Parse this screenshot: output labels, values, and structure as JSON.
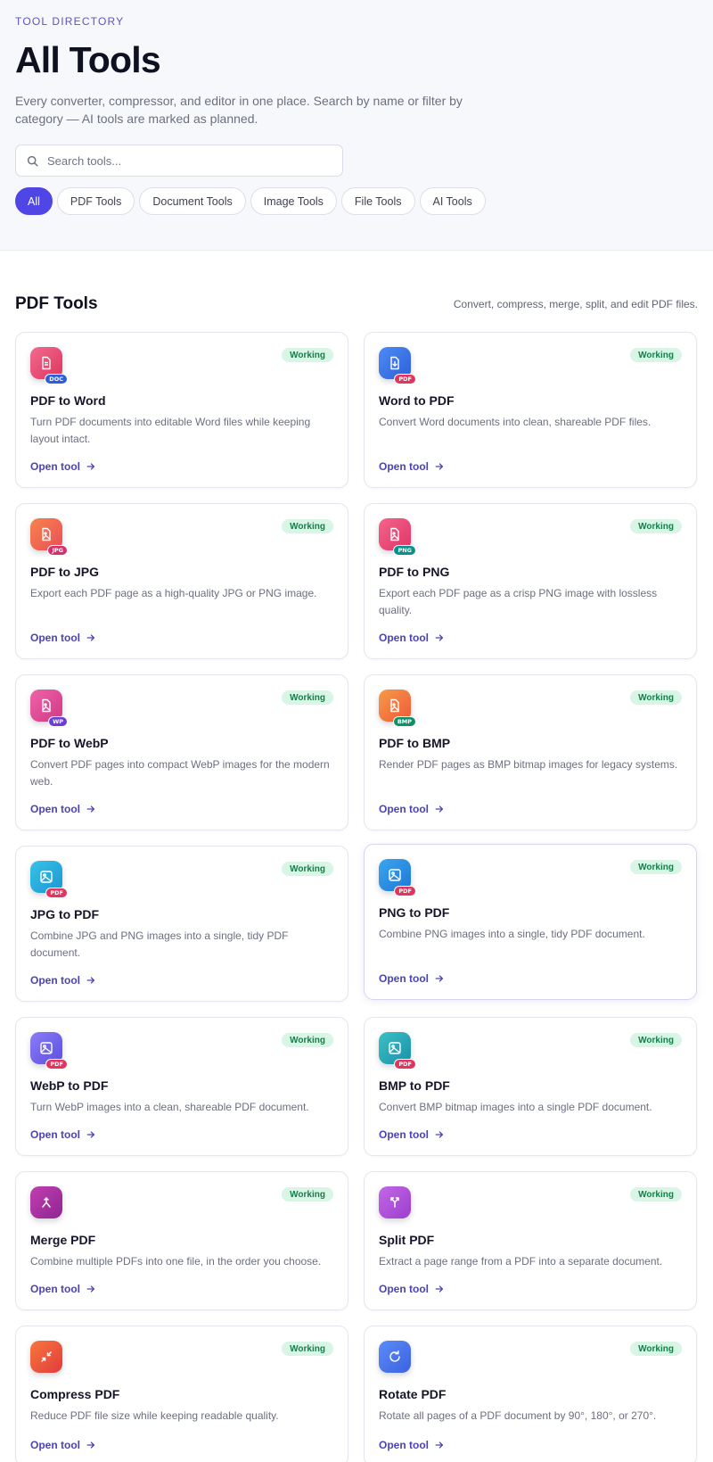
{
  "header": {
    "eyebrow": "TOOL DIRECTORY",
    "title": "All Tools",
    "description": "Every converter, compressor, and editor in one place. Search by name or filter by category — AI tools are marked as planned."
  },
  "search": {
    "placeholder": "Search tools..."
  },
  "filters": [
    {
      "label": "All",
      "active": true
    },
    {
      "label": "PDF Tools"
    },
    {
      "label": "Document Tools"
    },
    {
      "label": "Image Tools"
    },
    {
      "label": "File Tools"
    },
    {
      "label": "AI Tools"
    }
  ],
  "section": {
    "title": "PDF Tools",
    "subtitle": "Convert, compress, merge, split, and edit PDF files."
  },
  "link_label": "Open tool",
  "tools": [
    {
      "title": "PDF to Word",
      "description": "Turn PDF documents into editable Word files while keeping layout intact.",
      "status": "Working",
      "badge": "DOC",
      "icon": "document-icon"
    },
    {
      "title": "Word to PDF",
      "description": "Convert Word documents into clean, shareable PDF files.",
      "status": "Working",
      "badge": "PDF",
      "icon": "download-file-icon"
    },
    {
      "title": "PDF to JPG",
      "description": "Export each PDF page as a high-quality JPG or PNG image.",
      "status": "Working",
      "badge": "JPG",
      "icon": "image-file-icon"
    },
    {
      "title": "PDF to PNG",
      "description": "Export each PDF page as a crisp PNG image with lossless quality.",
      "status": "Working",
      "badge": "PNG",
      "icon": "image-file-icon"
    },
    {
      "title": "PDF to WebP",
      "description": "Convert PDF pages into compact WebP images for the modern web.",
      "status": "Working",
      "badge": "WP",
      "icon": "image-file-icon"
    },
    {
      "title": "PDF to BMP",
      "description": "Render PDF pages as BMP bitmap images for legacy systems.",
      "status": "Working",
      "badge": "BMP",
      "icon": "image-file-icon"
    },
    {
      "title": "JPG to PDF",
      "description": "Combine JPG and PNG images into a single, tidy PDF document.",
      "status": "Working",
      "badge": "PDF",
      "icon": "image-icon"
    },
    {
      "title": "PNG to PDF",
      "description": "Combine PNG images into a single, tidy PDF document.",
      "status": "Working",
      "badge": "PDF",
      "icon": "image-icon"
    },
    {
      "title": "WebP to PDF",
      "description": "Turn WebP images into a clean, shareable PDF document.",
      "status": "Working",
      "badge": "PDF",
      "icon": "image-icon"
    },
    {
      "title": "BMP to PDF",
      "description": "Convert BMP bitmap images into a single PDF document.",
      "status": "Working",
      "badge": "PDF",
      "icon": "image-icon"
    },
    {
      "title": "Merge PDF",
      "description": "Combine multiple PDFs into one file, in the order you choose.",
      "status": "Working",
      "badge": "",
      "icon": "merge-icon"
    },
    {
      "title": "Split PDF",
      "description": "Extract a page range from a PDF into a separate document.",
      "status": "Working",
      "badge": "",
      "icon": "split-icon"
    },
    {
      "title": "Compress PDF",
      "description": "Reduce PDF file size while keeping readable quality.",
      "status": "Working",
      "badge": "",
      "icon": "compress-icon"
    },
    {
      "title": "Rotate PDF",
      "description": "Rotate all pages of a PDF document by 90°, 180°, or 270°.",
      "status": "Working",
      "badge": "",
      "icon": "rotate-icon"
    }
  ],
  "colors": {
    "accent": "#4f46e5",
    "status_bg": "#d8f5e6",
    "status_text": "#157f4a"
  }
}
